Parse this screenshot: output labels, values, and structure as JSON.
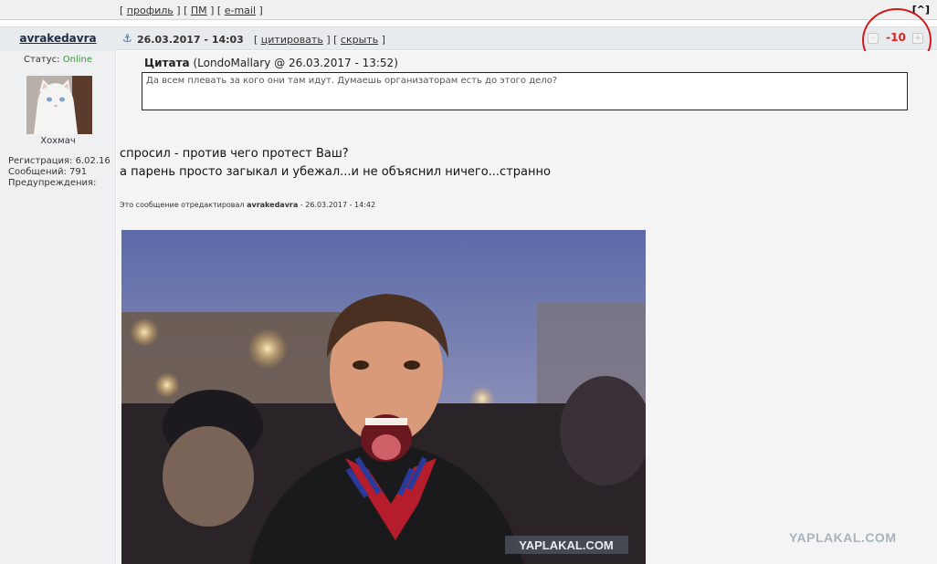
{
  "top_bar": {
    "bracket_open_1": "[",
    "profile_link": "профиль",
    "sep_1": "] [",
    "pm_link": "ПМ",
    "sep_2": "] [",
    "email_link": "e-mail",
    "bracket_close": "]",
    "to_top": "[^]"
  },
  "post": {
    "author": "avrakedavra",
    "date": "26.03.2017 - 14:03",
    "actions_open": "[",
    "quote_link": "цитировать",
    "actions_sep": "] [",
    "hide_link": "скрыть",
    "actions_close": "]",
    "rating": "-10",
    "rating_color": "#e02020",
    "highlight_color": "#d21a1a",
    "quote": {
      "label": "Цитата",
      "source": "(LondoMallary @ 26.03.2017 - 13:52)",
      "text": "Да всем плевать за кого они там идут. Думаешь организаторам есть до этого дело?"
    },
    "body_lines": [
      "спросил - против чего протест Ваш?",
      "а парень просто загыкал и убежал...и не объяснил ничего...странно"
    ],
    "edit_note": {
      "prefix": "Это сообщение отредактировал",
      "editor": "avrakedavra",
      "suffix": "- 26.03.2017 - 14:42"
    },
    "photo_watermark": "YAPLAKAL.COM"
  },
  "user": {
    "status_label": "Статус:",
    "status_value": "Online",
    "status_color": "#2aa02a",
    "avatar_caption": "Хохмач",
    "registration": "Регистрация: 6.02.16",
    "messages": "Сообщений: 791",
    "warnings": "Предупреждения:"
  },
  "site_watermark": "YAPLAKAL.COM",
  "icons": {
    "anchor": "anchor-icon",
    "minus": "rate-down-icon",
    "plus": "rate-up-icon"
  }
}
